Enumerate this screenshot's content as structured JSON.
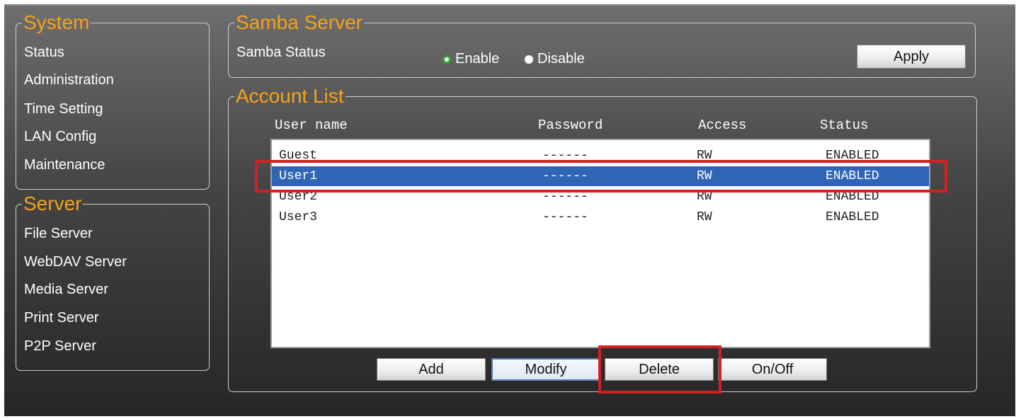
{
  "system_group": {
    "legend": "System",
    "items": [
      "Status",
      "Administration",
      "Time Setting",
      "LAN Config",
      "Maintenance"
    ]
  },
  "server_group": {
    "legend": "Server",
    "items": [
      "File Server",
      "WebDAV Server",
      "Media Server",
      "Print Server",
      "P2P Server"
    ]
  },
  "samba": {
    "legend": "Samba Server",
    "status_label": "Samba Status",
    "enable_label": "Enable",
    "disable_label": "Disable",
    "selected": "Enable",
    "apply_label": "Apply"
  },
  "account_list": {
    "legend": "Account List",
    "columns": [
      "User name",
      "Password",
      "Access",
      "Status"
    ],
    "rows": [
      {
        "user": "Guest",
        "password": "------",
        "access": "RW",
        "status": "ENABLED",
        "selected": false
      },
      {
        "user": "User1",
        "password": "------",
        "access": "RW",
        "status": "ENABLED",
        "selected": true
      },
      {
        "user": "User2",
        "password": "------",
        "access": "RW",
        "status": "ENABLED",
        "selected": false
      },
      {
        "user": "User3",
        "password": "------",
        "access": "RW",
        "status": "ENABLED",
        "selected": false
      }
    ],
    "buttons": {
      "add": "Add",
      "modify": "Modify",
      "delete": "Delete",
      "onoff": "On/Off"
    }
  },
  "colors": {
    "legend": "#f5a21a",
    "selection": "#2e66b5",
    "highlight": "#d42020"
  }
}
